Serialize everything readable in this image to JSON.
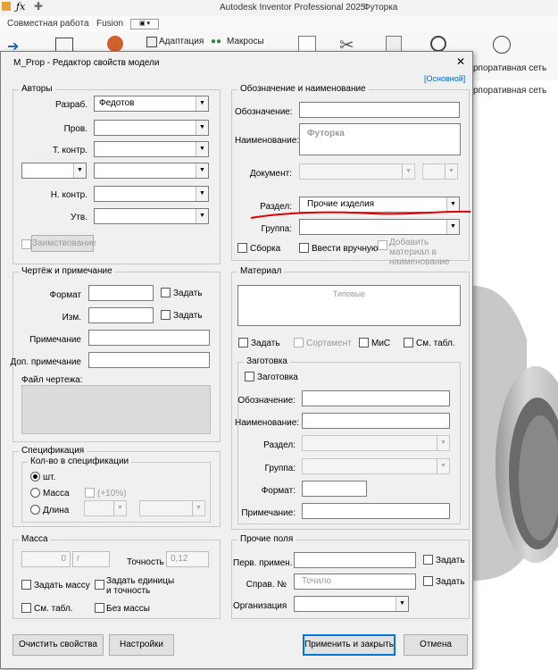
{
  "app": {
    "title": "Autodesk Inventor Professional 2025",
    "document": "Футорка",
    "tabs": [
      "Совместная работа",
      "Fusion"
    ],
    "ribbon": {
      "adaptation": "Адаптация",
      "macros": "Макросы",
      "corp_network_1": "рпоративная сеть",
      "corp_network_2": "рпоративная сеть"
    }
  },
  "dialog": {
    "title": "M_Prop -  Редактор свойств модели",
    "close_glyph": "✕",
    "basic_link": "[Основной]",
    "authors": {
      "title": "Авторы",
      "developer_label": "Разраб.",
      "developer_value": "Федотов",
      "checker_label": "Пров.",
      "tech_control_label": "Т. контр.",
      "norm_control_label": "Н. контр.",
      "approver_label": "Утв.",
      "borrow_button": "Заимствование"
    },
    "drawing": {
      "title": "Чертёж и примечание",
      "format_label": "Формат",
      "format_set": "Задать",
      "change_label": "Изм.",
      "change_set": "Задать",
      "note_label": "Примечание",
      "extra_note_label": "Доп. примечание",
      "drawing_file_label": "Файл чертежа:"
    },
    "spec": {
      "title": "Спецификация",
      "qty_title": "Кол-во в спецификации",
      "pcs": "шт.",
      "mass": "Масса",
      "length": "Длина",
      "plus10": "(+10%)"
    },
    "mass": {
      "title": "Масса",
      "value": "0",
      "unit": "г",
      "accuracy_label": "Точность",
      "accuracy_value": "0,12",
      "set_mass": "Задать массу",
      "set_units": "Задать единицы и точность",
      "sm_table": "См. табл.",
      "no_mass": "Без массы"
    },
    "designation": {
      "title": "Обозначение и наименование",
      "designation_label": "Обозначение:",
      "name_label": "Наименование:",
      "name_value": "Футорка",
      "document_label": "Документ:",
      "section_label": "Раздел:",
      "section_value": "Прочие изделия",
      "group_label": "Группа:",
      "assembly": "Сборка",
      "manual": "Ввести вручную",
      "add_material": "Добавить материал в наименование"
    },
    "material": {
      "title": "Материал",
      "value": "Типовые",
      "set": "Задать",
      "assortment": "Сортамент",
      "mis": "МиС",
      "sm_table": "См. табл."
    },
    "blank": {
      "title": "Заготовка",
      "checkbox": "Заготовка",
      "designation_label": "Обозначение:",
      "name_label": "Наименование:",
      "section_label": "Раздел:",
      "group_label": "Группа:",
      "format_label": "Формат:",
      "note_label": "Примечание:"
    },
    "other": {
      "title": "Прочие поля",
      "first_use_label": "Перв. примен.",
      "set1": "Задать",
      "ref_label": "Справ. №",
      "ref_placeholder": "Точило",
      "set2": "Задать",
      "org_label": "Организация"
    },
    "buttons": {
      "clear": "Очистить свойства",
      "settings": "Настройки",
      "apply_close": "Применить и закрыть",
      "cancel": "Отмена"
    }
  },
  "colors": {
    "annotation_underline": "#e00000",
    "link": "#0066cc"
  }
}
